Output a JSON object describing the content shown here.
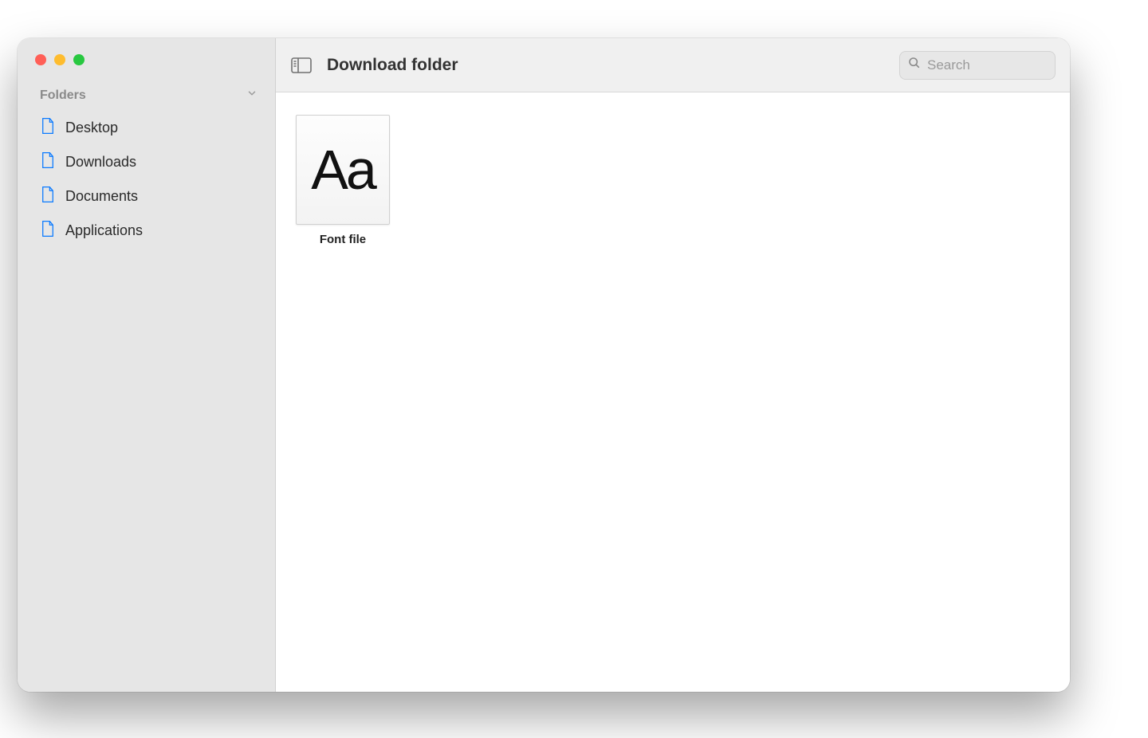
{
  "sidebar": {
    "section_title": "Folders",
    "items": [
      {
        "label": "Desktop"
      },
      {
        "label": "Downloads"
      },
      {
        "label": "Documents"
      },
      {
        "label": "Applications"
      }
    ]
  },
  "toolbar": {
    "title": "Download folder",
    "search_placeholder": "Search"
  },
  "content": {
    "files": [
      {
        "label": "Font file",
        "glyph": "Aa"
      }
    ]
  }
}
